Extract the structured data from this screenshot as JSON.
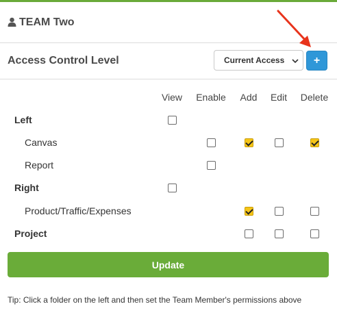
{
  "team": {
    "name": "TEAM Two",
    "icon": "user-icon"
  },
  "acl": {
    "title": "Access Control Level",
    "select_value": "Current Access",
    "add_label": "+"
  },
  "columns": [
    "View",
    "Enable",
    "Add",
    "Edit",
    "Delete"
  ],
  "rows": [
    {
      "label": "Left",
      "bold": true,
      "view": false,
      "enable": null,
      "add": null,
      "edit": null,
      "delete": null
    },
    {
      "label": "Canvas",
      "bold": false,
      "view": null,
      "enable": false,
      "add": true,
      "edit": false,
      "delete": true
    },
    {
      "label": "Report",
      "bold": false,
      "view": null,
      "enable": false,
      "add": null,
      "edit": null,
      "delete": null
    },
    {
      "label": "Right",
      "bold": true,
      "view": false,
      "enable": null,
      "add": null,
      "edit": null,
      "delete": null
    },
    {
      "label": "Product/Traffic/Expenses",
      "bold": false,
      "view": null,
      "enable": null,
      "add": true,
      "edit": false,
      "delete": false
    },
    {
      "label": "Project",
      "bold": true,
      "view": null,
      "enable": null,
      "add": false,
      "edit": false,
      "delete": false
    }
  ],
  "update_label": "Update",
  "tip": "Tip: Click a folder on the left and then set the Team Member's permissions above",
  "colors": {
    "accent_green": "#6aac39",
    "button_blue": "#2f97d8",
    "checkbox_yellow": "#f5c518",
    "arrow_red": "#e8341c"
  }
}
